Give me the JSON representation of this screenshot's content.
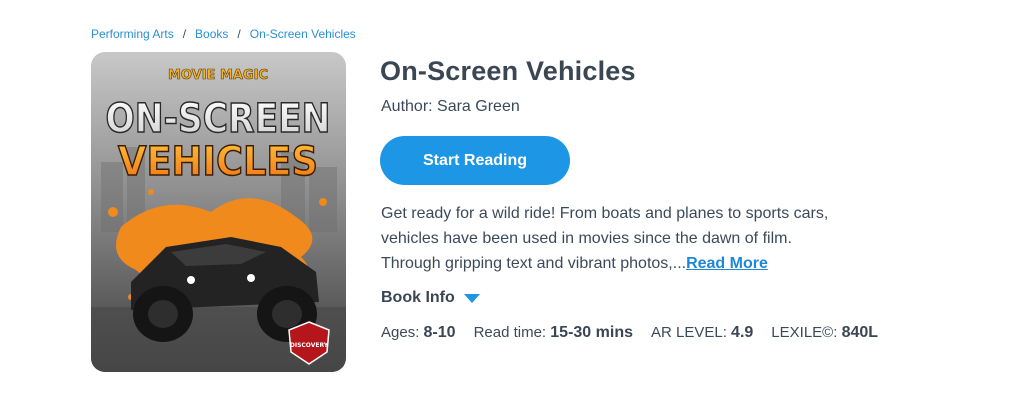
{
  "breadcrumb": {
    "items": [
      "Performing Arts",
      "Books",
      "On-Screen Vehicles"
    ],
    "separator": "/"
  },
  "cover": {
    "series_label": "MOVIE MAGIC",
    "title_line1": "ON-SCREEN",
    "title_line2": "VEHICLES",
    "publisher_badge": "DISCOVERY"
  },
  "book": {
    "title": "On-Screen Vehicles",
    "author": "Author: Sara Green",
    "start_label": "Start Reading",
    "description_lines": [
      "Get ready for a wild ride! From boats and planes to sports cars,",
      "vehicles have been used in movies since the dawn of film.",
      "Through gripping text and vibrant photos,..."
    ],
    "read_more": "Read More",
    "book_info_label": "Book Info"
  },
  "meta": {
    "ages_label": "Ages:",
    "ages": "8-10",
    "read_time_label": "Read time:",
    "read_time": "15-30 mins",
    "ar_label": "AR LEVEL:",
    "ar": "4.9",
    "lexile_label": "LEXILE©:",
    "lexile": "840L"
  },
  "colors": {
    "accent": "#1e96e6",
    "link": "#2b8fd6",
    "text": "#3b4a5a",
    "cover_orange": "#f08a1c"
  }
}
